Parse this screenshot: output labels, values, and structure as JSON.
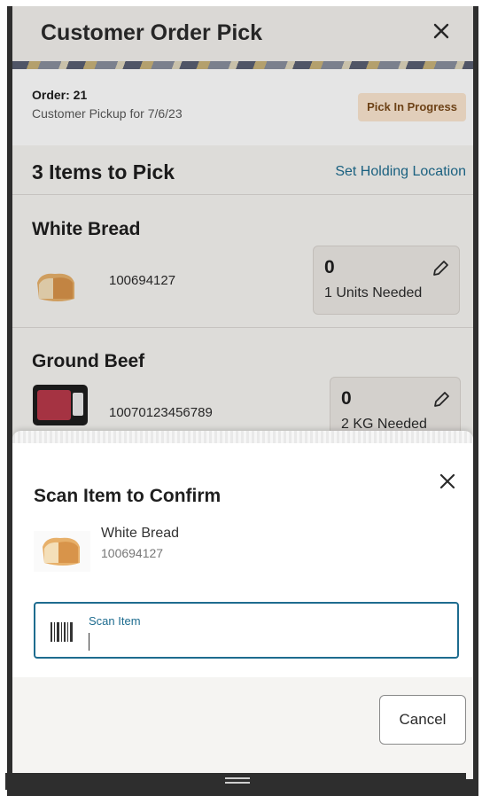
{
  "header": {
    "title": "Customer Order Pick",
    "close_icon": "close-icon"
  },
  "order": {
    "number": "Order: 21",
    "subtitle": "Customer Pickup for 7/6/23",
    "status": "Pick In Progress"
  },
  "items_header": {
    "count_label": "3 Items to Pick",
    "holding_link": "Set Holding Location"
  },
  "items": [
    {
      "name": "White Bread",
      "sku": "100694127",
      "picked": "0",
      "needed": "1 Units Needed",
      "thumb_icon": "bread-icon",
      "edit_icon": "pencil-icon"
    },
    {
      "name": "Ground Beef",
      "sku": "10070123456789",
      "picked": "0",
      "needed": "2 KG Needed",
      "thumb_icon": "ground-beef-icon",
      "edit_icon": "pencil-icon"
    }
  ],
  "sheet": {
    "title": "Scan Item to Confirm",
    "item_name": "White Bread",
    "item_sku": "100694127",
    "scan_label": "Scan Item",
    "cancel_label": "Cancel",
    "barcode_icon": "barcode-icon",
    "close_icon": "close-icon"
  },
  "colors": {
    "accent": "#1e6c8f",
    "badge_bg": "#fbe6d0",
    "badge_text": "#7a4a1a"
  }
}
